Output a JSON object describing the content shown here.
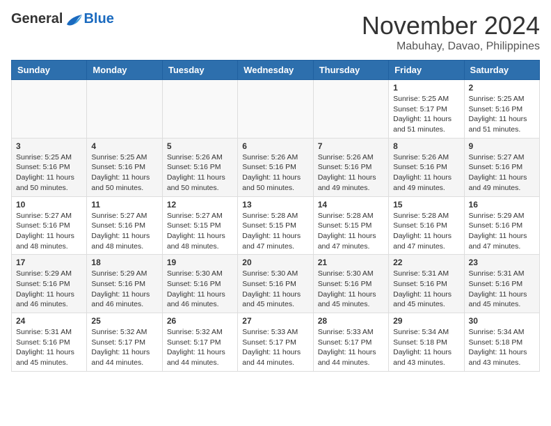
{
  "logo": {
    "general": "General",
    "blue": "Blue"
  },
  "title": "November 2024",
  "location": "Mabuhay, Davao, Philippines",
  "days_of_week": [
    "Sunday",
    "Monday",
    "Tuesday",
    "Wednesday",
    "Thursday",
    "Friday",
    "Saturday"
  ],
  "weeks": [
    [
      {
        "day": "",
        "info": ""
      },
      {
        "day": "",
        "info": ""
      },
      {
        "day": "",
        "info": ""
      },
      {
        "day": "",
        "info": ""
      },
      {
        "day": "",
        "info": ""
      },
      {
        "day": "1",
        "info": "Sunrise: 5:25 AM\nSunset: 5:17 PM\nDaylight: 11 hours\nand 51 minutes."
      },
      {
        "day": "2",
        "info": "Sunrise: 5:25 AM\nSunset: 5:16 PM\nDaylight: 11 hours\nand 51 minutes."
      }
    ],
    [
      {
        "day": "3",
        "info": "Sunrise: 5:25 AM\nSunset: 5:16 PM\nDaylight: 11 hours\nand 50 minutes."
      },
      {
        "day": "4",
        "info": "Sunrise: 5:25 AM\nSunset: 5:16 PM\nDaylight: 11 hours\nand 50 minutes."
      },
      {
        "day": "5",
        "info": "Sunrise: 5:26 AM\nSunset: 5:16 PM\nDaylight: 11 hours\nand 50 minutes."
      },
      {
        "day": "6",
        "info": "Sunrise: 5:26 AM\nSunset: 5:16 PM\nDaylight: 11 hours\nand 50 minutes."
      },
      {
        "day": "7",
        "info": "Sunrise: 5:26 AM\nSunset: 5:16 PM\nDaylight: 11 hours\nand 49 minutes."
      },
      {
        "day": "8",
        "info": "Sunrise: 5:26 AM\nSunset: 5:16 PM\nDaylight: 11 hours\nand 49 minutes."
      },
      {
        "day": "9",
        "info": "Sunrise: 5:27 AM\nSunset: 5:16 PM\nDaylight: 11 hours\nand 49 minutes."
      }
    ],
    [
      {
        "day": "10",
        "info": "Sunrise: 5:27 AM\nSunset: 5:16 PM\nDaylight: 11 hours\nand 48 minutes."
      },
      {
        "day": "11",
        "info": "Sunrise: 5:27 AM\nSunset: 5:16 PM\nDaylight: 11 hours\nand 48 minutes."
      },
      {
        "day": "12",
        "info": "Sunrise: 5:27 AM\nSunset: 5:15 PM\nDaylight: 11 hours\nand 48 minutes."
      },
      {
        "day": "13",
        "info": "Sunrise: 5:28 AM\nSunset: 5:15 PM\nDaylight: 11 hours\nand 47 minutes."
      },
      {
        "day": "14",
        "info": "Sunrise: 5:28 AM\nSunset: 5:15 PM\nDaylight: 11 hours\nand 47 minutes."
      },
      {
        "day": "15",
        "info": "Sunrise: 5:28 AM\nSunset: 5:16 PM\nDaylight: 11 hours\nand 47 minutes."
      },
      {
        "day": "16",
        "info": "Sunrise: 5:29 AM\nSunset: 5:16 PM\nDaylight: 11 hours\nand 47 minutes."
      }
    ],
    [
      {
        "day": "17",
        "info": "Sunrise: 5:29 AM\nSunset: 5:16 PM\nDaylight: 11 hours\nand 46 minutes."
      },
      {
        "day": "18",
        "info": "Sunrise: 5:29 AM\nSunset: 5:16 PM\nDaylight: 11 hours\nand 46 minutes."
      },
      {
        "day": "19",
        "info": "Sunrise: 5:30 AM\nSunset: 5:16 PM\nDaylight: 11 hours\nand 46 minutes."
      },
      {
        "day": "20",
        "info": "Sunrise: 5:30 AM\nSunset: 5:16 PM\nDaylight: 11 hours\nand 45 minutes."
      },
      {
        "day": "21",
        "info": "Sunrise: 5:30 AM\nSunset: 5:16 PM\nDaylight: 11 hours\nand 45 minutes."
      },
      {
        "day": "22",
        "info": "Sunrise: 5:31 AM\nSunset: 5:16 PM\nDaylight: 11 hours\nand 45 minutes."
      },
      {
        "day": "23",
        "info": "Sunrise: 5:31 AM\nSunset: 5:16 PM\nDaylight: 11 hours\nand 45 minutes."
      }
    ],
    [
      {
        "day": "24",
        "info": "Sunrise: 5:31 AM\nSunset: 5:16 PM\nDaylight: 11 hours\nand 45 minutes."
      },
      {
        "day": "25",
        "info": "Sunrise: 5:32 AM\nSunset: 5:17 PM\nDaylight: 11 hours\nand 44 minutes."
      },
      {
        "day": "26",
        "info": "Sunrise: 5:32 AM\nSunset: 5:17 PM\nDaylight: 11 hours\nand 44 minutes."
      },
      {
        "day": "27",
        "info": "Sunrise: 5:33 AM\nSunset: 5:17 PM\nDaylight: 11 hours\nand 44 minutes."
      },
      {
        "day": "28",
        "info": "Sunrise: 5:33 AM\nSunset: 5:17 PM\nDaylight: 11 hours\nand 44 minutes."
      },
      {
        "day": "29",
        "info": "Sunrise: 5:34 AM\nSunset: 5:18 PM\nDaylight: 11 hours\nand 43 minutes."
      },
      {
        "day": "30",
        "info": "Sunrise: 5:34 AM\nSunset: 5:18 PM\nDaylight: 11 hours\nand 43 minutes."
      }
    ]
  ]
}
